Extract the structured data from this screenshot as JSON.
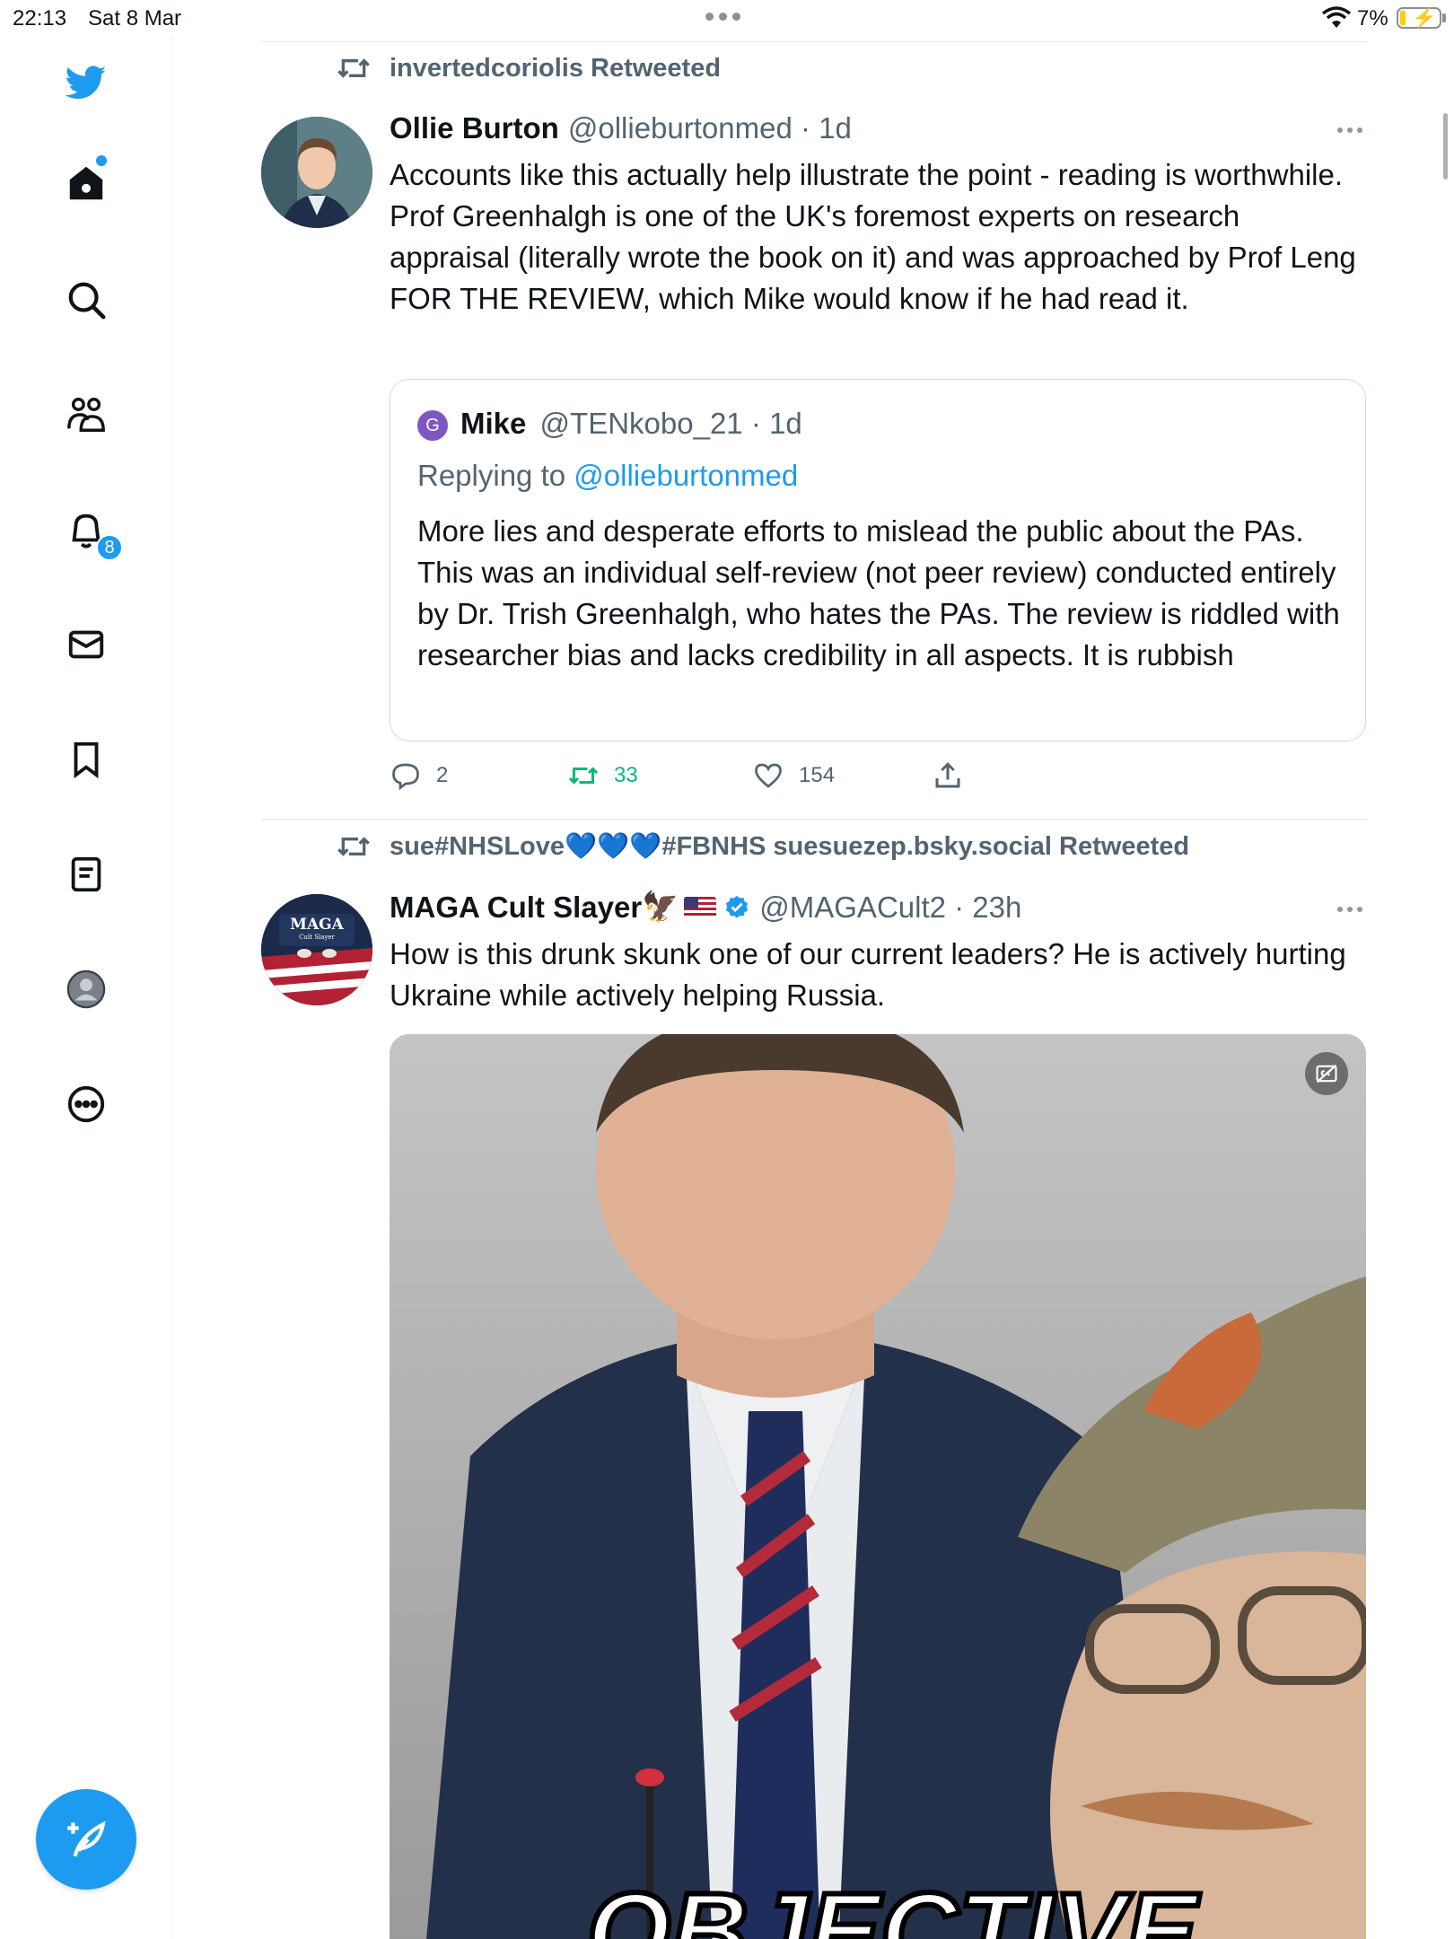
{
  "status_bar": {
    "time": "22:13",
    "date": "Sat 8 Mar",
    "battery_pct": "7%"
  },
  "sidebar": {
    "items": [
      {
        "name": "twitter-logo"
      },
      {
        "name": "home"
      },
      {
        "name": "search"
      },
      {
        "name": "communities"
      },
      {
        "name": "notifications",
        "badge": "8"
      },
      {
        "name": "messages"
      },
      {
        "name": "bookmarks"
      },
      {
        "name": "lists"
      },
      {
        "name": "profile"
      },
      {
        "name": "more"
      }
    ],
    "accent": "#1d9bf0"
  },
  "tweets": [
    {
      "retweeted_by": "invertedcoriolis Retweeted",
      "name": "Ollie Burton",
      "handle": "@ollieburtonmed · 1d",
      "text": "Accounts like this actually help illustrate the point - reading is worthwhile. Prof Greenhalgh is one of the UK's foremost experts on research appraisal (literally wrote the book on it) and was approached by Prof Leng FOR THE REVIEW, which Mike would know if he had read it.",
      "quote": {
        "avatar_letter": "G",
        "name": "Mike",
        "handle": "@TENkobo_21 · 1d",
        "replying_prefix": "Replying to ",
        "replying_to": "@ollieburtonmed",
        "text": "More lies and desperate efforts to mislead the public about the PAs. This was an individual self-review (not peer review) conducted entirely by Dr. Trish Greenhalgh, who hates the PAs. The review is riddled with researcher bias and lacks credibility in all aspects. It is rubbish"
      },
      "replies": "2",
      "retweets": "33",
      "likes": "154"
    },
    {
      "retweeted_by": "sue#NHSLove💙💙💙#FBNHS suesuezep.bsky.social Retweeted",
      "name": "MAGA Cult Slayer",
      "name_emoji": "🦅",
      "handle": "@MAGACult2 · 23h",
      "avatar_text": "MAGA",
      "avatar_subtext": "Cult Slayer",
      "text": "How is this drunk skunk one of our current leaders? He is actively hurting Ukraine while actively helping Russia.",
      "media_caption_fragment": "OBJECTIVE"
    }
  ]
}
